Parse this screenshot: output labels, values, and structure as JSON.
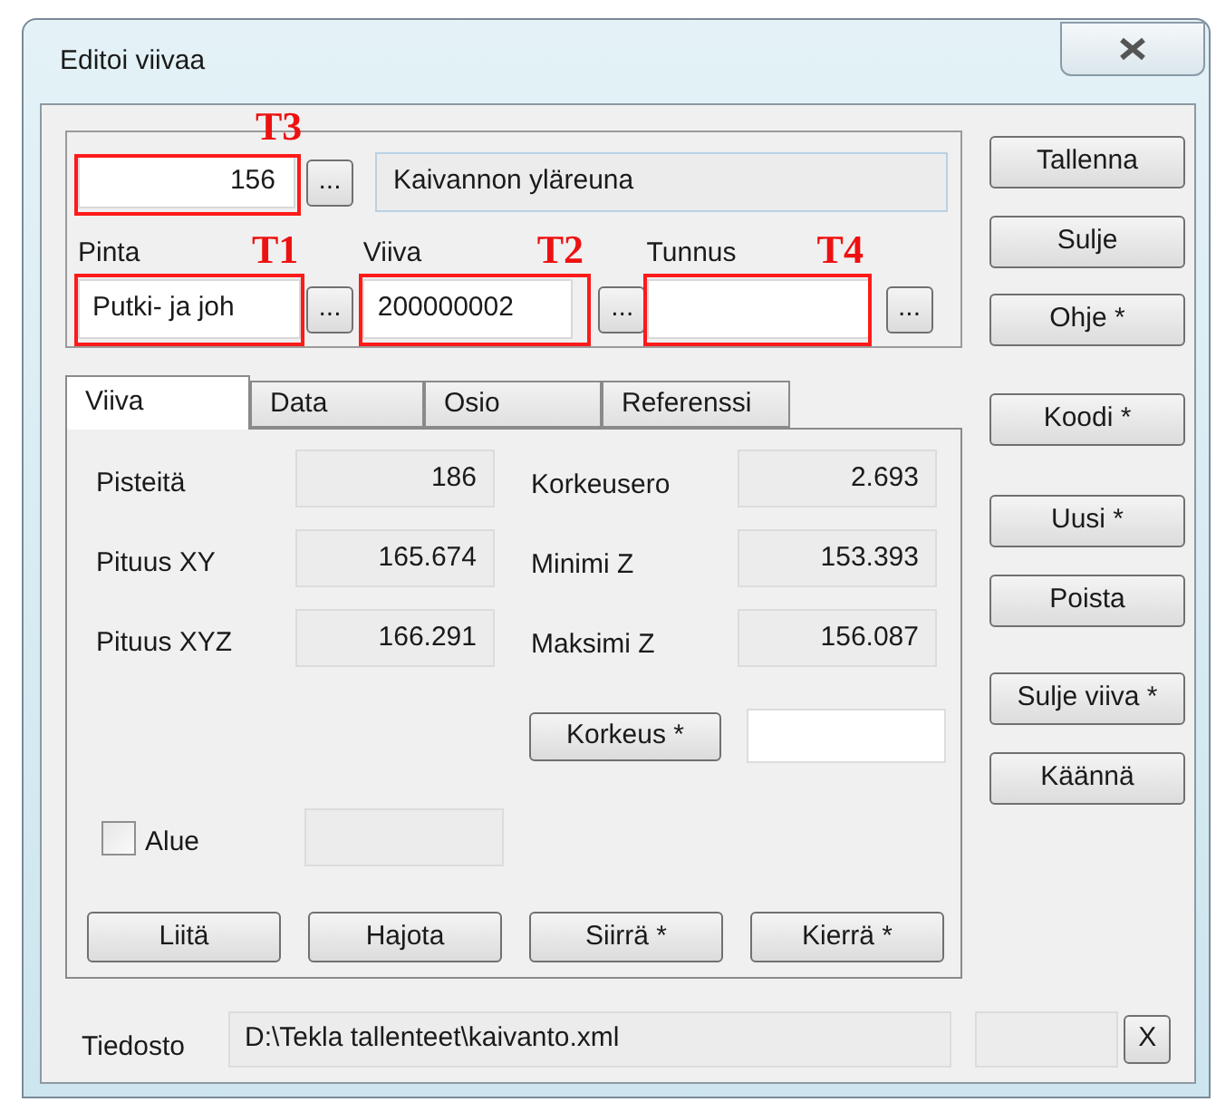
{
  "window": {
    "title": "Editoi viivaa"
  },
  "header": {
    "number": {
      "value": "156",
      "browse": "...",
      "annotation": "T3"
    },
    "description": "Kaivannon yläreuna"
  },
  "fields": [
    {
      "label": "Pinta",
      "value": "Putki- ja joh",
      "browse": "...",
      "annotation": "T1"
    },
    {
      "label": "Viiva",
      "value": "200000002",
      "browse": "...",
      "annotation": "T2"
    },
    {
      "label": "Tunnus",
      "browse": "...",
      "annotation": "T4"
    }
  ],
  "tabs": [
    {
      "label": "Viiva",
      "selected": true
    },
    {
      "label": "Data",
      "selected": false
    },
    {
      "label": "Osio",
      "selected": false
    },
    {
      "label": "Referenssi",
      "selected": false
    }
  ],
  "stats": [
    {
      "label": "Pisteitä",
      "value": "186"
    },
    {
      "label": "Korkeusero",
      "value": "2.693"
    },
    {
      "label": "Pituus XY",
      "value": "165.674"
    },
    {
      "label": "Minimi Z",
      "value": "153.393"
    },
    {
      "label": "Pituus XYZ",
      "value": "166.291"
    },
    {
      "label": "Maksimi Z",
      "value": "156.087"
    }
  ],
  "height_button": "Korkeus *",
  "area": {
    "label": "Alue",
    "checked": false
  },
  "actions": [
    "Liitä",
    "Hajota",
    "Siirrä *",
    "Kierrä *"
  ],
  "side_buttons": [
    "Tallenna",
    "Sulje",
    "Ohje *",
    "Koodi *",
    "Uusi *",
    "Poista",
    "Sulje viiva *",
    "Käännä"
  ],
  "file": {
    "label": "Tiedosto",
    "path": "D:\\Tekla tallenteet\\kaivanto.xml",
    "clear_button": "X"
  }
}
